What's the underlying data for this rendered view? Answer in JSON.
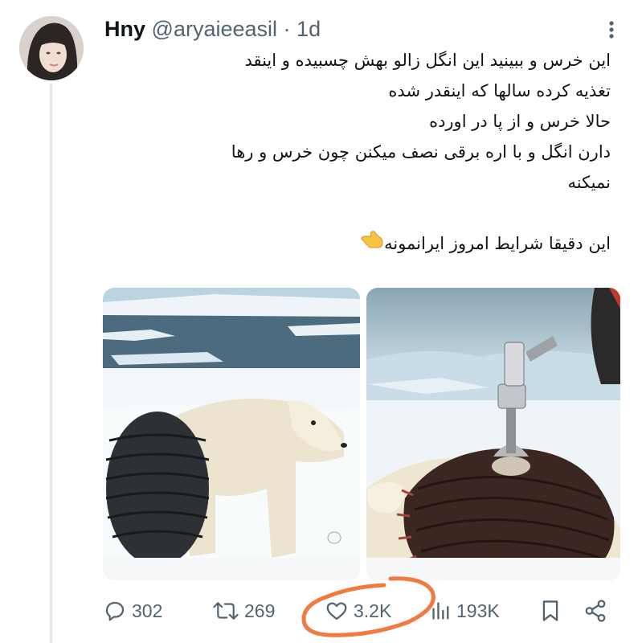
{
  "tweet": {
    "author_name": "Hny",
    "author_handle": "@aryaieeasil",
    "separator": "·",
    "time": "1d",
    "lines": [
      "این خرس و ببینید این انگل زالو بهش چسبیده و اینقد",
      "تغذیه کرده سالها که اینقدر شده",
      "حالا خرس و از پا در اورده",
      "دارن انگل و با اره برقی نصف میکنن چون خرس و رها",
      "نمیکنه"
    ],
    "closing_line": "این دقیقا شرایط امروز ایرانمونه",
    "closing_emoji": "backhand-index-pointing-left-emoji"
  },
  "media": {
    "images": [
      {
        "name": "polar-bear-with-giant-isopod-image"
      },
      {
        "name": "isopod-on-bear-with-tool-image"
      }
    ]
  },
  "actions": {
    "replies": "302",
    "reposts": "269",
    "likes": "3.2K",
    "views": "193K"
  },
  "icons": {
    "reply": "reply-icon",
    "repost": "repost-icon",
    "like": "heart-icon",
    "views": "views-chart-icon",
    "bookmark": "bookmark-icon",
    "share": "share-icon",
    "more": "more-options-icon"
  },
  "colors": {
    "text": "#0f1419",
    "muted": "#536471",
    "annotation_circle": "#f07a3f"
  }
}
